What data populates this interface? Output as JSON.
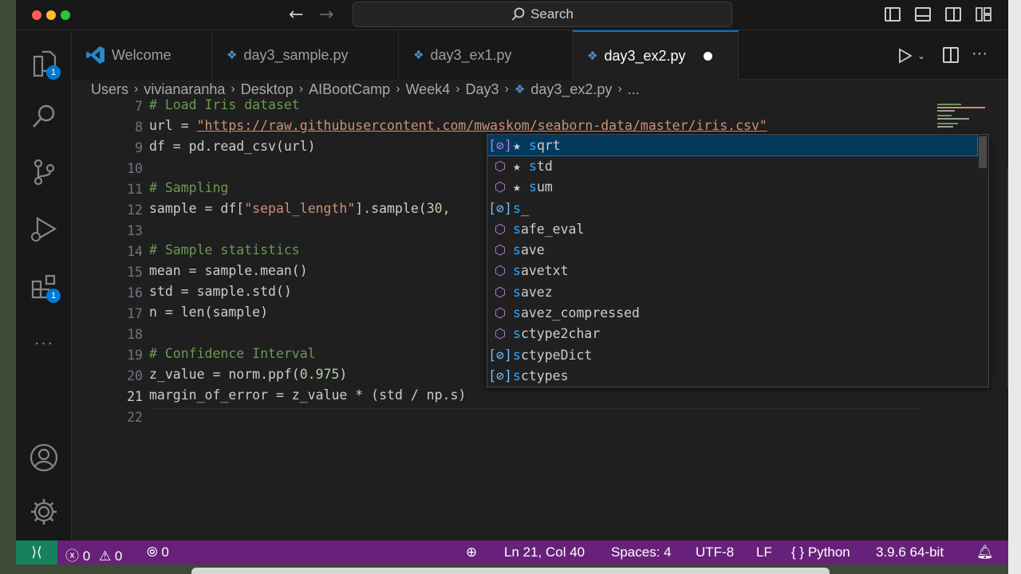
{
  "titlebar": {
    "search_label": "Search",
    "back_arrow": "←",
    "forward_arrow": "→"
  },
  "activity": {
    "explorer_badge": "1",
    "extensions_badge": "1",
    "more": "···"
  },
  "tabs": [
    {
      "label": "Welcome",
      "icon": "vscode-icon"
    },
    {
      "label": "day3_sample.py",
      "icon": "python-icon"
    },
    {
      "label": "day3_ex1.py",
      "icon": "python-icon"
    },
    {
      "label": "day3_ex2.py",
      "icon": "python-icon",
      "active": true,
      "modified": true
    }
  ],
  "breadcrumb": [
    "Users",
    "vivianaranha",
    "Desktop",
    "AIBootCamp",
    "Week4",
    "Day3",
    "day3_ex2.py",
    "..."
  ],
  "editor": {
    "line_numbers": [
      "7",
      "8",
      "9",
      "10",
      "11",
      "12",
      "13",
      "14",
      "15",
      "16",
      "17",
      "18",
      "19",
      "20",
      "21",
      "22"
    ],
    "lines": {
      "l7": "# Load Iris dataset",
      "l8_a": "url = ",
      "l8_url": "\"https://raw.githubusercontent.com/mwaskom/seaborn-data/master/iris.csv\"",
      "l9": "df = pd.read_csv(url)",
      "l11": "# Sampling",
      "l12_a": "sample = df[",
      "l12_str": "\"sepal_length\"",
      "l12_b": "].sample(",
      "l12_num": "30",
      "l12_c": ",",
      "l14": "# Sample statistics",
      "l15": "mean = sample.mean()",
      "l16": "std = sample.std()",
      "l17": "n = len(sample)",
      "l19": "# Confidence Interval",
      "l20_a": "z_value = norm.ppf(",
      "l20_num": "0.975",
      "l20_b": ")",
      "l21": "margin_of_error = z_value * (std / np.s)"
    }
  },
  "suggestions": [
    {
      "label_hl": "s",
      "label_rest": "qrt",
      "starred": true,
      "kind": "method",
      "selected": true
    },
    {
      "label_hl": "s",
      "label_rest": "td",
      "starred": true,
      "kind": "method"
    },
    {
      "label_hl": "s",
      "label_rest": "um",
      "starred": true,
      "kind": "method"
    },
    {
      "label_hl": "s",
      "label_rest": "_",
      "starred": false,
      "kind": "variable"
    },
    {
      "label_hl": "s",
      "label_rest": "afe_eval",
      "starred": false,
      "kind": "method"
    },
    {
      "label_hl": "s",
      "label_rest": "ave",
      "starred": false,
      "kind": "method"
    },
    {
      "label_hl": "s",
      "label_rest": "avetxt",
      "starred": false,
      "kind": "method"
    },
    {
      "label_hl": "s",
      "label_rest": "avez",
      "starred": false,
      "kind": "method"
    },
    {
      "label_hl": "s",
      "label_rest": "avez_compressed",
      "starred": false,
      "kind": "method"
    },
    {
      "label_hl": "s",
      "label_rest": "ctype2char",
      "starred": false,
      "kind": "method"
    },
    {
      "label_hl": "s",
      "label_rest": "ctypeDict",
      "starred": false,
      "kind": "variable"
    },
    {
      "label_hl": "s",
      "label_rest": "ctypes",
      "starred": false,
      "kind": "variable"
    }
  ],
  "status": {
    "errors": "0",
    "warnings": "0",
    "ports": "0",
    "position": "Ln 21, Col 40",
    "spaces": "Spaces: 4",
    "encoding": "UTF-8",
    "eol": "LF",
    "language": "Python",
    "interpreter": "3.9.6 64-bit"
  },
  "colors": {
    "accent": "#0078d4",
    "statusbar": "#68217a",
    "remote": "#16825d"
  }
}
